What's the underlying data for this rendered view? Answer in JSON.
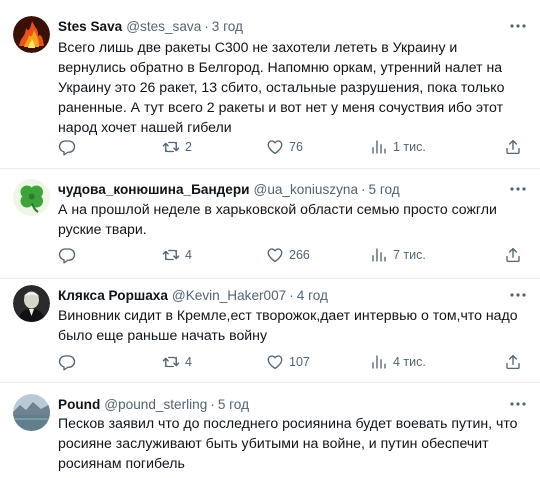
{
  "icons": {
    "reply": "comment-icon",
    "retweet": "retweet-icon",
    "like": "heart-icon",
    "views": "views-chart-icon",
    "share": "share-icon",
    "more": "more-dots-icon"
  },
  "tweets": [
    {
      "name": "Stes Sava",
      "handle": "@stes_sava",
      "sep": "·",
      "time": "3 год",
      "text": "Всего лишь две ракеты С300 не захотели лететь в Украину и вернулись обратно в Белгород. Напомню оркам, утренний налет на Украину это 26 ракет, 13 сбито, остальные разрушения, пока только раненные. А тут всего 2 ракеты и вот нет у меня сочуствия ибо этот народ хочет нашей гибели",
      "retweets": "2",
      "likes": "76",
      "views": "1 тис."
    },
    {
      "name": "чудова_конюшина_Бандери",
      "handle": "@ua_koniuszyna",
      "sep": "·",
      "time": "5 год",
      "text": "А на прошлой неделе в харьковской области семью просто сожгли руские твари.",
      "retweets": "4",
      "likes": "266",
      "views": "7 тис."
    },
    {
      "name": "Клякса Роршаха",
      "handle": "@Kevin_Haker007",
      "sep": "·",
      "time": "4 год",
      "text": "Виновник сидит в Кремле,ест творожок,дает интервью о том,что надо было еще раньше начать войну",
      "retweets": "4",
      "likes": "107",
      "views": "4 тис."
    },
    {
      "name": "Pound",
      "handle": "@pound_sterling",
      "sep": "·",
      "time": "5 год",
      "text": "Песков заявил что до последнего росиянина будет воевать путин, что росияне заслуживают быть убитыми на войне, и путин обеспечит росиянам погибель",
      "retweets": "",
      "likes": "",
      "views": ""
    }
  ]
}
